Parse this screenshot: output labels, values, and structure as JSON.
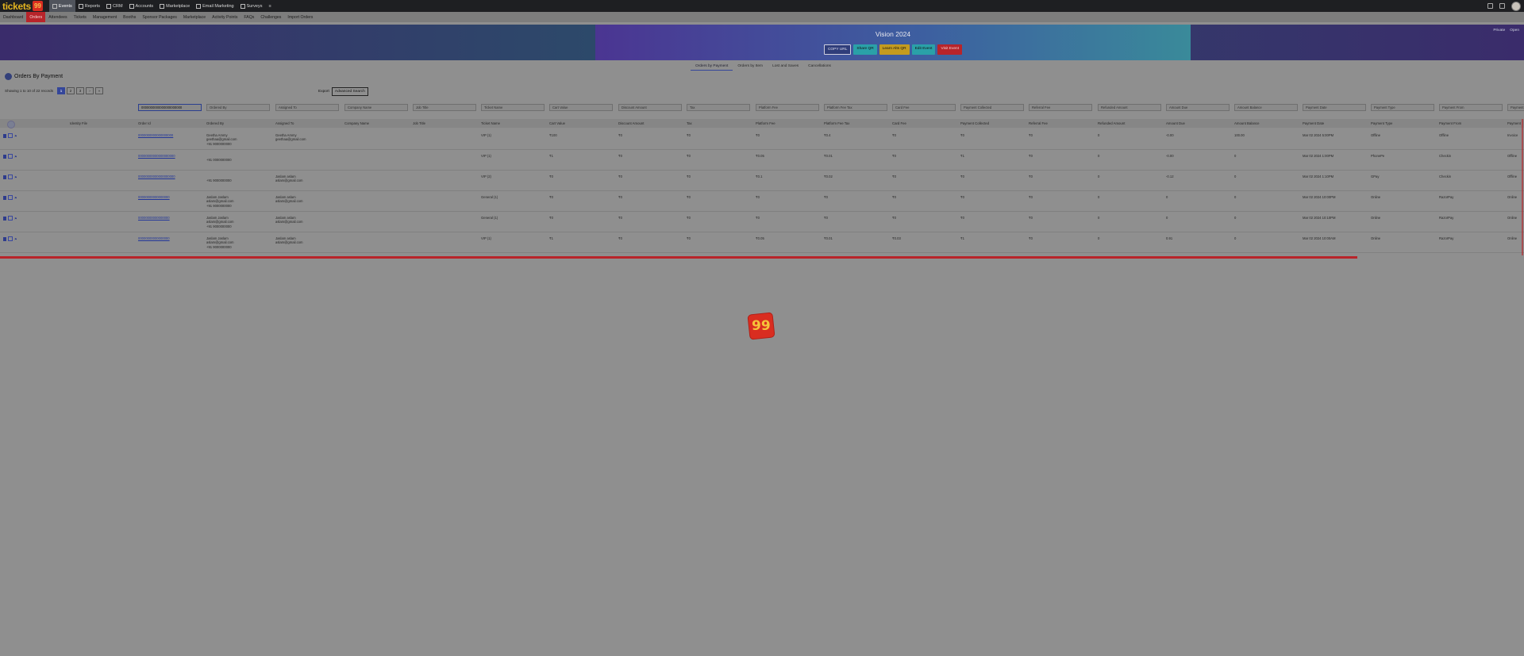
{
  "brand": {
    "text": "tickets",
    "badge": "99"
  },
  "top_nav": [
    {
      "label": "Events",
      "active": true
    },
    {
      "label": "Reports",
      "active": false
    },
    {
      "label": "CRM",
      "active": false
    },
    {
      "label": "Accounts",
      "active": false
    },
    {
      "label": "Marketplace",
      "active": false
    },
    {
      "label": "Email Marketing",
      "active": false
    },
    {
      "label": "Surveys",
      "active": false
    },
    {
      "label": "≡",
      "active": false
    }
  ],
  "sub_nav": [
    {
      "label": "Dashboard",
      "active": false
    },
    {
      "label": "Orders",
      "active": true
    },
    {
      "label": "Attendees",
      "active": false
    },
    {
      "label": "Tickets",
      "active": false
    },
    {
      "label": "Management",
      "active": false
    },
    {
      "label": "Booths",
      "active": false
    },
    {
      "label": "Sponsor Packages",
      "active": false
    },
    {
      "label": "Marketplace",
      "active": false
    },
    {
      "label": "Activity Points",
      "active": false
    },
    {
      "label": "FAQs",
      "active": false
    },
    {
      "label": "Challenges",
      "active": false
    },
    {
      "label": "Import Orders",
      "active": false
    }
  ],
  "banner": {
    "title": "Vision 2024",
    "buttons": {
      "copy": "COPY URL",
      "share": "Share QR",
      "learn": "Learn Alts QR",
      "edit": "Edit Event",
      "visit": "Visit Event"
    },
    "right_links": {
      "private": "Private",
      "open": "Open"
    }
  },
  "tabs": [
    {
      "label": "Orders by Payment",
      "active": true
    },
    {
      "label": "Orders by Item",
      "active": false
    },
    {
      "label": "Lost and Saves",
      "active": false
    },
    {
      "label": "Cancellations",
      "active": false
    }
  ],
  "page": {
    "title": "Orders By Payment",
    "showing": "Showing 1 to 10 of 22 records",
    "pages": [
      "1",
      "2",
      "3",
      "›",
      "»"
    ],
    "export": "Export",
    "advanced_search": "Advanced Search"
  },
  "filters": [
    "0000000000000000000000",
    "Ordered By",
    "Assigned To",
    "Company Name",
    "Job Title",
    "Ticket Name",
    "Cart Value",
    "Discount Amount",
    "Tax",
    "Platform Fee",
    "Platform Fee Tax",
    "Card Fee",
    "Payment Collected",
    "Referral Fee",
    "Refunded Amount",
    "Amount Due",
    "Amount Balance",
    "Payment Date",
    "Payment Type",
    "Payment From",
    "Payment"
  ],
  "columns": [
    "Identity File",
    "Order Id",
    "Ordered By",
    "Assigned To",
    "Company Name",
    "Job Title",
    "Ticket Name",
    "Cart Value",
    "Discount Amount",
    "Tax",
    "Platform Fee",
    "Platform Fee Tax",
    "Card Fee",
    "Payment Collected",
    "Referral Fee",
    "Refunded Amount",
    "Amount Due",
    "Amount Balance",
    "Payment Date",
    "Payment Type",
    "Payment From",
    "Payment"
  ],
  "rows": [
    {
      "order_id": "0000000000000000000",
      "ordered_by": "Geetha Ammy\ngeethaa@gmail.com\n+91 9000000000",
      "assigned_to": "Geetha Ammy\ngeethaa@gmail.com",
      "company": "",
      "job": "",
      "ticket": "VIP (1)",
      "cart": "₹100",
      "discount": "₹0",
      "tax": "₹0",
      "pfee": "₹0",
      "pfee_tax": "₹0.4",
      "card": "₹0",
      "collected": "₹0",
      "referral": "₹0",
      "refunded": "0",
      "due": "-0.00",
      "balance": "100.00",
      "date": "Mar 02 2024 5:00PM",
      "ptype": "Offline",
      "pfrom": "Offline",
      "payment": "Invoice"
    },
    {
      "order_id": "00000000000000000000",
      "ordered_by": "\n+91 0000000000",
      "assigned_to": "",
      "company": "",
      "job": "",
      "ticket": "VIP (1)",
      "cart": "₹1",
      "discount": "₹0",
      "tax": "₹0",
      "pfee": "₹0.05",
      "pfee_tax": "₹0.01",
      "card": "₹0",
      "collected": "₹1",
      "referral": "₹0",
      "refunded": "0",
      "due": "-0.00",
      "balance": "0",
      "date": "Mar 02 2024 1:00PM",
      "ptype": "PhonePe",
      "pfrom": "Checkin",
      "payment": "Offline"
    },
    {
      "order_id": "00000000000000000000",
      "ordered_by": "\n+91 9000000000",
      "assigned_to": "Jaslam aslam\naslam@gmail.com",
      "company": "",
      "job": "",
      "ticket": "VIP (2)",
      "cart": "₹0",
      "discount": "₹0",
      "tax": "₹0",
      "pfee": "₹0.1",
      "pfee_tax": "₹0.02",
      "card": "₹0",
      "collected": "₹0",
      "referral": "₹0",
      "refunded": "0",
      "due": "-0.12",
      "balance": "0",
      "date": "Mar 02 2024 1:10PM",
      "ptype": "GPay",
      "pfrom": "Checkin",
      "payment": "Offline"
    },
    {
      "order_id": "00000000000000000",
      "ordered_by": "Jaslam Jaslam\naslam@gmail.com\n+91 9000000000",
      "assigned_to": "Jaslam aslam\naslam@gmail.com",
      "company": "",
      "job": "",
      "ticket": "General (1)",
      "cart": "₹0",
      "discount": "₹0",
      "tax": "₹0",
      "pfee": "₹0",
      "pfee_tax": "₹0",
      "card": "₹0",
      "collected": "₹0",
      "referral": "₹0",
      "refunded": "0",
      "due": "0",
      "balance": "0",
      "date": "Mar 02 2024 10:00PM",
      "ptype": "Online",
      "pfrom": "RazorPay",
      "payment": "Online"
    },
    {
      "order_id": "00000000000000000",
      "ordered_by": "Jaslam Jaslam\naslam@gmail.com\n+91 9000000000",
      "assigned_to": "Jaslam aslam\naslam@gmail.com",
      "company": "",
      "job": "",
      "ticket": "General (1)",
      "cart": "₹0",
      "discount": "₹0",
      "tax": "₹0",
      "pfee": "₹0",
      "pfee_tax": "₹0",
      "card": "₹0",
      "collected": "₹0",
      "referral": "₹0",
      "refunded": "0",
      "due": "0",
      "balance": "0",
      "date": "Mar 02 2024 10:10PM",
      "ptype": "Online",
      "pfrom": "RazorPay",
      "payment": "Online"
    },
    {
      "order_id": "00000000000000000",
      "ordered_by": "Jaslam Jaslam\naslam@gmail.com\n+91 9000000000",
      "assigned_to": "Jaslam aslam\naslam@gmail.com",
      "company": "",
      "job": "",
      "ticket": "VIP (1)",
      "cart": "₹1",
      "discount": "₹0",
      "tax": "₹0",
      "pfee": "₹0.05",
      "pfee_tax": "₹0.01",
      "card": "₹0.03",
      "collected": "₹1",
      "referral": "₹0",
      "refunded": "0",
      "due": "0.91",
      "balance": "0",
      "date": "Mar 02 2024 10:00AM",
      "ptype": "Online",
      "pfrom": "RazorPay",
      "payment": "Online"
    }
  ],
  "loader": {
    "text": "99"
  },
  "colors": {
    "accent": "#34469a",
    "brand_red": "#d92d20",
    "brand_yellow": "#e4b520"
  }
}
